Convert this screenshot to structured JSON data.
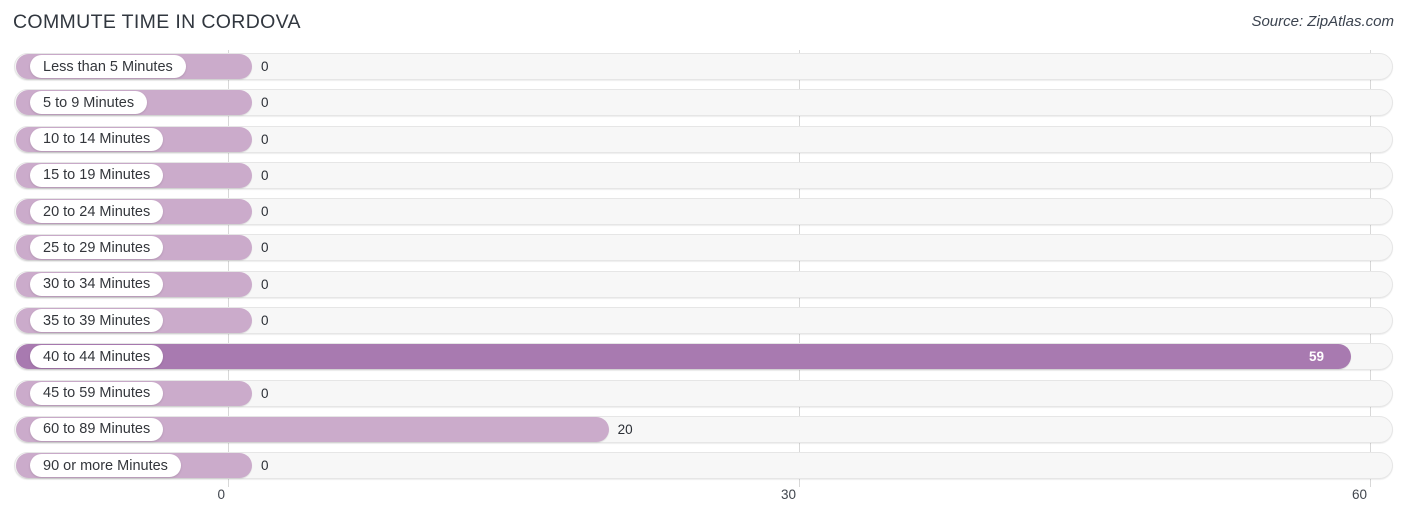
{
  "header": {
    "title": "COMMUTE TIME IN CORDOVA",
    "source": "Source: ZipAtlas.com"
  },
  "chart_data": {
    "type": "bar",
    "orientation": "horizontal",
    "title": "COMMUTE TIME IN CORDOVA",
    "xlabel": "",
    "ylabel": "",
    "xlim": [
      0,
      60
    ],
    "grid": true,
    "legend": null,
    "xticks": [
      "0",
      "30",
      "60"
    ],
    "xtick_values": [
      0,
      30,
      60
    ],
    "categories": [
      "Less than 5 Minutes",
      "5 to 9 Minutes",
      "10 to 14 Minutes",
      "15 to 19 Minutes",
      "20 to 24 Minutes",
      "25 to 29 Minutes",
      "30 to 34 Minutes",
      "35 to 39 Minutes",
      "40 to 44 Minutes",
      "45 to 59 Minutes",
      "60 to 89 Minutes",
      "90 or more Minutes"
    ],
    "values": [
      0,
      0,
      0,
      0,
      0,
      0,
      0,
      0,
      59,
      0,
      20,
      0
    ],
    "value_labels": [
      "0",
      "0",
      "0",
      "0",
      "0",
      "0",
      "0",
      "0",
      "59",
      "0",
      "20",
      "0"
    ],
    "colors": {
      "bar": "#cbabcb",
      "bar_highlight": "#a87ab0",
      "track": "#f7f7f7",
      "track_border": "#e6e6e6",
      "gridline": "#d8d8d8",
      "title_text": "#31373f",
      "label_text": "#33363b",
      "value_text": "#2b2f36",
      "value_text_inside": "#ffffff"
    }
  }
}
